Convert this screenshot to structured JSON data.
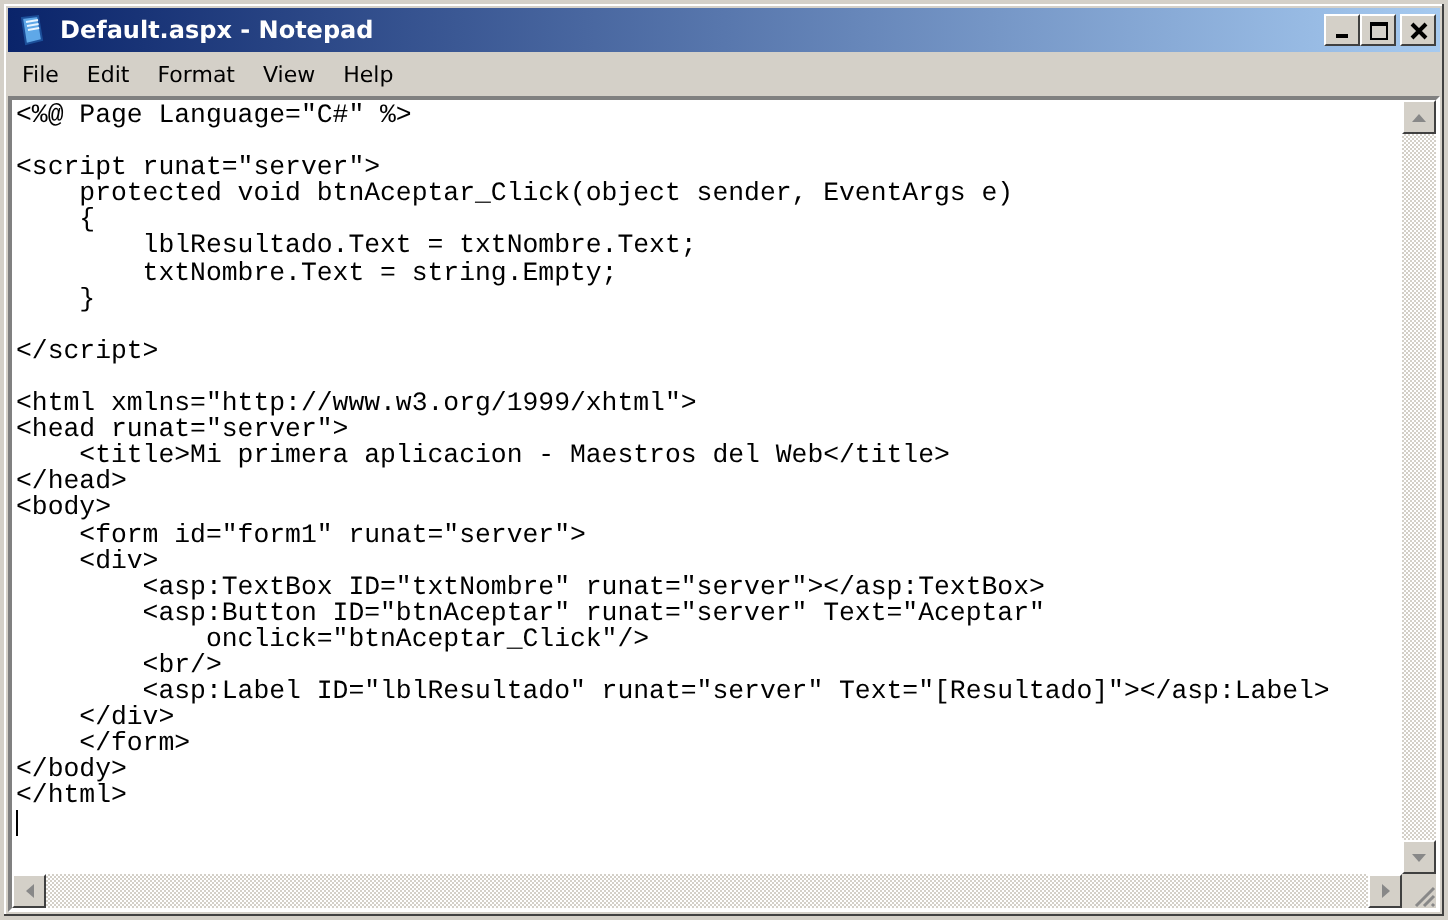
{
  "window": {
    "title": "Default.aspx - Notepad"
  },
  "menu": [
    "File",
    "Edit",
    "Format",
    "View",
    "Help"
  ],
  "editor": {
    "text": "<%@ Page Language=\"C#\" %>\n\n<script runat=\"server\">\n    protected void btnAceptar_Click(object sender, EventArgs e)\n    {\n        lblResultado.Text = txtNombre.Text;\n        txtNombre.Text = string.Empty;\n    }\n\n</script>\n\n<html xmlns=\"http://www.w3.org/1999/xhtml\">\n<head runat=\"server\">\n    <title>Mi primera aplicacion - Maestros del Web</title>\n</head>\n<body>\n    <form id=\"form1\" runat=\"server\">\n    <div>\n        <asp:TextBox ID=\"txtNombre\" runat=\"server\"></asp:TextBox>\n        <asp:Button ID=\"btnAceptar\" runat=\"server\" Text=\"Aceptar\"\n            onclick=\"btnAceptar_Click\"/>\n        <br/>\n        <asp:Label ID=\"lblResultado\" runat=\"server\" Text=\"[Resultado]\"></asp:Label>\n    </div>\n    </form>\n</body>\n</html>"
  }
}
